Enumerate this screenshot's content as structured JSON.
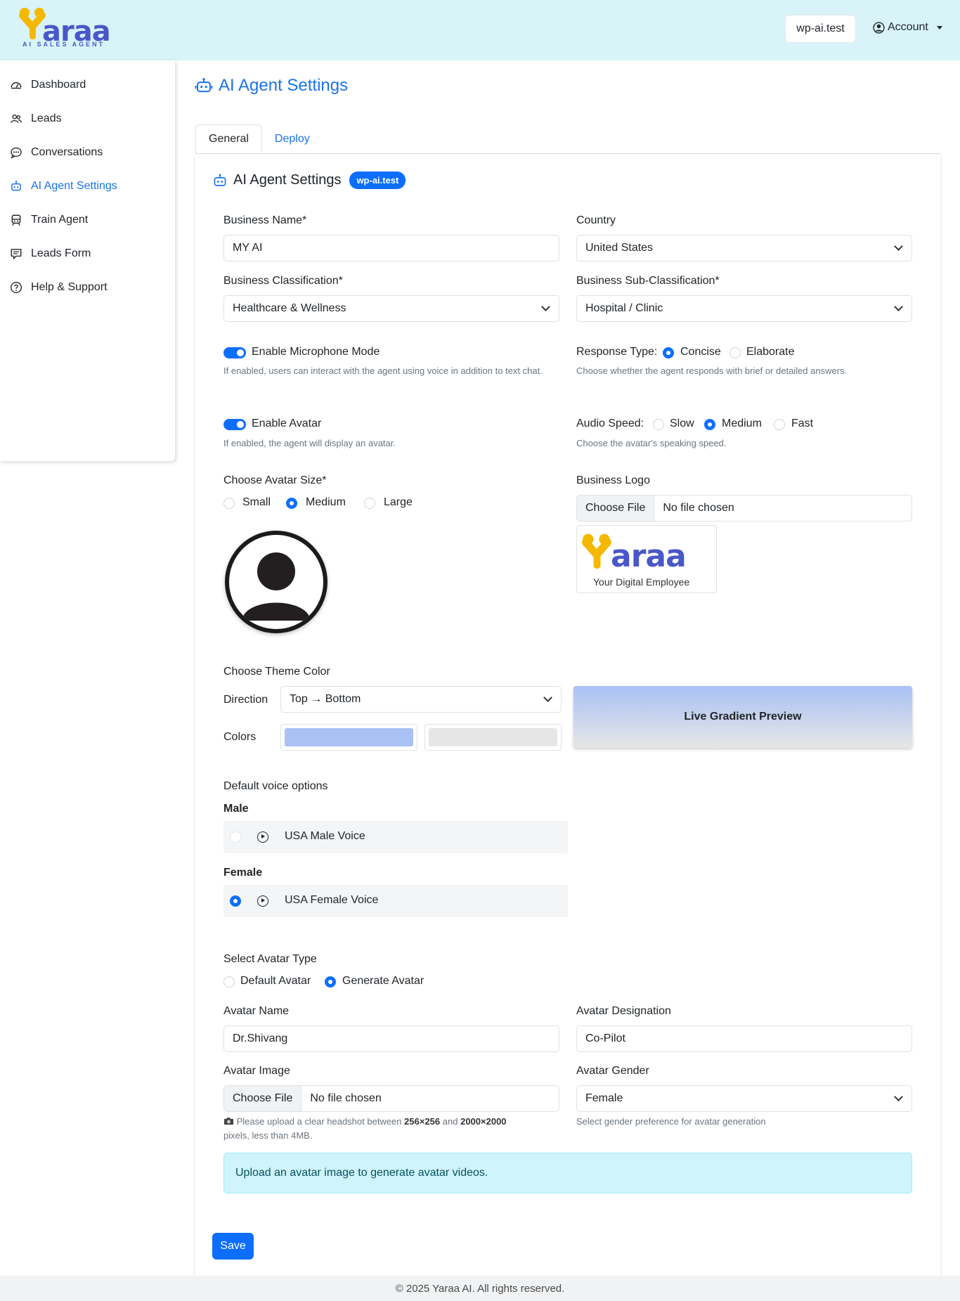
{
  "header": {
    "logo_word": "araa",
    "logo_tagline": "AI SALES AGENT",
    "site_chip": "wp-ai.test",
    "account_label": "Account"
  },
  "sidebar": {
    "items": [
      {
        "label": "Dashboard",
        "icon": "dashboard-icon"
      },
      {
        "label": "Leads",
        "icon": "people-icon"
      },
      {
        "label": "Conversations",
        "icon": "chat-icon"
      },
      {
        "label": "AI Agent Settings",
        "icon": "robot-icon",
        "active": true
      },
      {
        "label": "Train Agent",
        "icon": "train-icon"
      },
      {
        "label": "Leads Form",
        "icon": "form-icon"
      },
      {
        "label": "Help & Support",
        "icon": "help-icon"
      }
    ]
  },
  "page": {
    "title": "AI Agent Settings",
    "tabs": [
      "General",
      "Deploy"
    ],
    "card_title": "AI Agent Settings",
    "card_badge": "wp-ai.test"
  },
  "form": {
    "business_name_label": "Business Name*",
    "business_name_value": "MY AI",
    "country_label": "Country",
    "country_value": "United States",
    "classification_label": "Business Classification*",
    "classification_value": "Healthcare & Wellness",
    "subclassification_label": "Business Sub-Classification*",
    "subclassification_value": "Hospital / Clinic",
    "mic_label": "Enable Microphone Mode",
    "mic_help": "If enabled, users can interact with the agent using voice in addition to text chat.",
    "response_type_label": "Response Type:",
    "response_concise": "Concise",
    "response_elaborate": "Elaborate",
    "response_help": "Choose whether the agent responds with brief or detailed answers.",
    "avatar_enable_label": "Enable Avatar",
    "avatar_enable_help": "If enabled, the agent will display an avatar.",
    "audio_speed_label": "Audio Speed:",
    "audio_slow": "Slow",
    "audio_medium": "Medium",
    "audio_fast": "Fast",
    "audio_help": "Choose the avatar's speaking speed.",
    "avatar_size_label": "Choose Avatar Size*",
    "size_small": "Small",
    "size_medium": "Medium",
    "size_large": "Large",
    "business_logo_label": "Business Logo",
    "choose_file": "Choose File",
    "no_file": "No file chosen",
    "logo_preview_word": "araa",
    "logo_preview_tagline": "Your Digital Employee",
    "theme_label": "Choose Theme Color",
    "direction_label": "Direction",
    "direction_value": "Top → Bottom",
    "colors_label": "Colors",
    "color_1": "#a9c1f5",
    "color_2": "#e6e6e6",
    "gradient_preview": "Live Gradient Preview",
    "voice_label": "Default voice options",
    "male_label": "Male",
    "male_voice": "USA Male Voice",
    "female_label": "Female",
    "female_voice": "USA Female Voice",
    "avatar_type_label": "Select Avatar Type",
    "avatar_type_default": "Default Avatar",
    "avatar_type_generate": "Generate Avatar",
    "avatar_name_label": "Avatar Name",
    "avatar_name_value": "Dr.Shivang",
    "avatar_designation_label": "Avatar Designation",
    "avatar_designation_value": "Co-Pilot",
    "avatar_image_label": "Avatar Image",
    "avatar_image_help_1": "Please upload a clear headshot between",
    "avatar_image_help_min": "256×256",
    "avatar_image_help_and": "and",
    "avatar_image_help_max": "2000×2000",
    "avatar_image_help_2": "pixels, less than 4MB.",
    "avatar_gender_label": "Avatar Gender",
    "avatar_gender_value": "Female",
    "avatar_gender_help": "Select gender preference for avatar generation",
    "info_text": "Upload an avatar image to generate avatar videos.",
    "save_label": "Save"
  },
  "footer": {
    "text": "© 2025 Yaraa AI. All rights reserved."
  },
  "colors": {
    "accent": "#0d6efd",
    "link": "#1a73e8",
    "topbar": "#d8f4f8",
    "logo_yellow": "#f5b800",
    "logo_blue": "#4a57c9"
  }
}
